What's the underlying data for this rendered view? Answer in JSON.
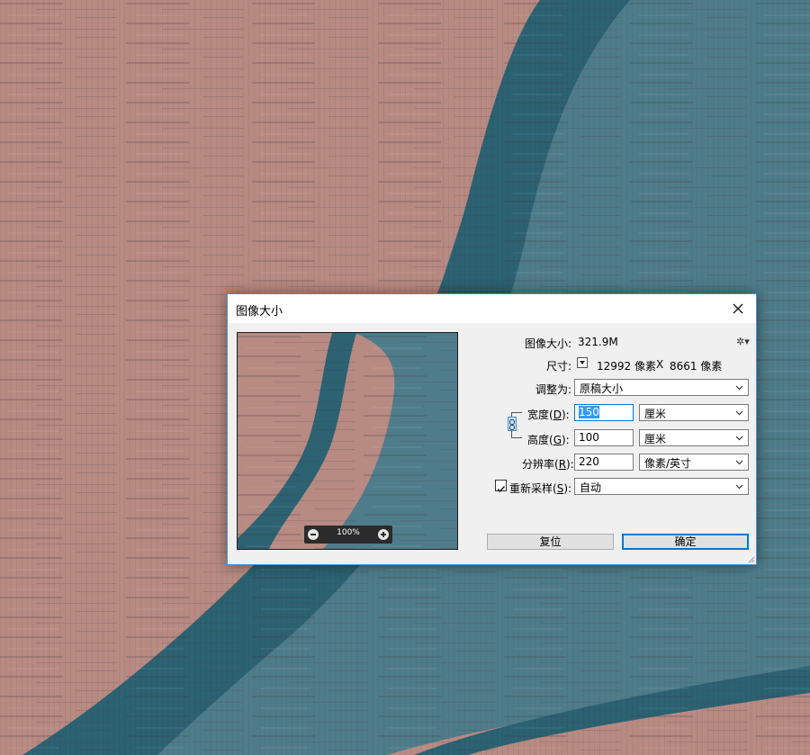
{
  "colors": {
    "pink": "#b78a82",
    "teal_dark": "#2c6272",
    "teal_light": "#4f7c8a",
    "accent": "#0078d7"
  },
  "dialog": {
    "title": "图像大小",
    "image_size_label": "图像大小:",
    "image_size_value": "321.9M",
    "dimensions_label": "尺寸:",
    "dim_width": "12992 像素",
    "dim_sep": "X",
    "dim_height": "8661 像素",
    "fit_label": "调整为:",
    "fit_value": "原稿大小",
    "width_label_pre": "宽度(",
    "width_key": "D",
    "width_label_post": "):",
    "width_value": "150",
    "width_unit": "厘米",
    "height_label_pre": "高度(",
    "height_key": "G",
    "height_label_post": "):",
    "height_value": "100",
    "height_unit": "厘米",
    "resolution_label_pre": "分辨率(",
    "resolution_key": "R",
    "resolution_label_post": "):",
    "resolution_value": "220",
    "resolution_unit": "像素/英寸",
    "resample_label_pre": "重新采样(",
    "resample_key": "S",
    "resample_label_post": "):",
    "resample_checked": true,
    "resample_value": "自动",
    "zoom": "100%",
    "reset_label": "复位",
    "ok_label": "确定"
  }
}
